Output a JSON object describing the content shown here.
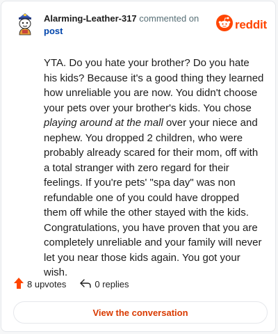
{
  "header": {
    "username": "Alarming-Leather-317",
    "action_text": " commented on ",
    "post_link": "post",
    "brand": "reddit"
  },
  "comment": {
    "part1": "YTA. Do you hate your brother? Do you hate his kids? Because it's a good thing they learned how unreliable you are now. You didn't choose your pets over your brother's kids. You chose ",
    "italic": "playing around at the mall",
    "part2": " over your niece and nephew. You dropped 2 children, who were probably already scared for their mom, off with a total stranger with zero regard for their feelings. If you're pets' \"spa day\" was non refundable one of you could have dropped them off while the other stayed with the kids. Congratulations, you have proven that you are completely unreliable and your family will never let you near those kids again. You got your wish."
  },
  "actions": {
    "upvotes": "8 upvotes",
    "replies": "0 replies"
  },
  "cta": {
    "label": "View the conversation"
  },
  "colors": {
    "brand": "#ff4500",
    "link": "#0045ac",
    "cta": "#d93a00"
  },
  "icons": [
    "avatar",
    "reddit-logo-icon",
    "upvote-arrow-icon",
    "reply-arrow-icon"
  ]
}
